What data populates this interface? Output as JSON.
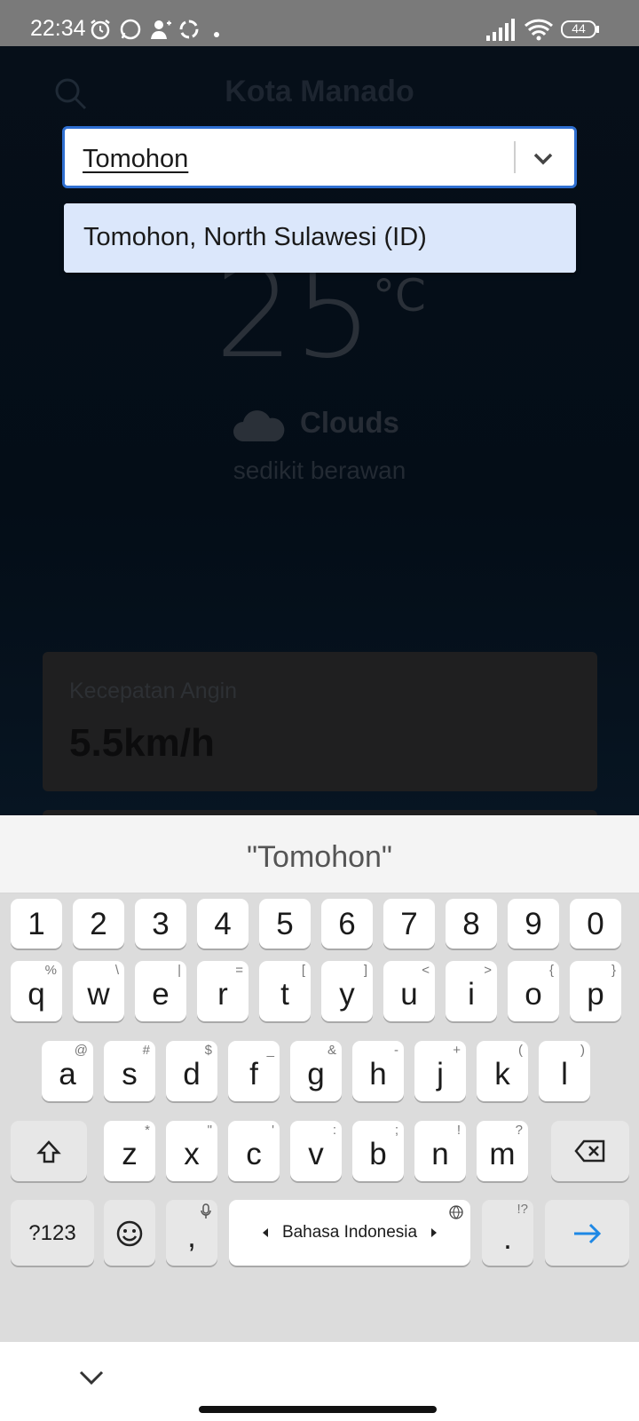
{
  "status_bar": {
    "time": "22:34",
    "battery": "44",
    "icons": [
      "alarm-icon",
      "whatsapp-icon",
      "contact-sync-icon",
      "sync-icon",
      "dot-icon",
      "signal-icon",
      "wifi-icon",
      "battery-icon"
    ]
  },
  "app": {
    "city_title": "Kota Manado",
    "temperature": "25",
    "temperature_unit": "°C",
    "weather_main": "Clouds",
    "weather_description": "sedikit berawan",
    "wind": {
      "label": "Kecepatan Angin",
      "value": "5.5km/h"
    }
  },
  "search": {
    "value": "Tomohon",
    "options": [
      "Tomohon, North Sulawesi (ID)"
    ]
  },
  "keyboard": {
    "suggestion": "\"Tomohon\"",
    "number_row": [
      "1",
      "2",
      "3",
      "4",
      "5",
      "6",
      "7",
      "8",
      "9",
      "0"
    ],
    "row1": [
      {
        "c": "q",
        "s": "%"
      },
      {
        "c": "w",
        "s": "\\"
      },
      {
        "c": "e",
        "s": "|"
      },
      {
        "c": "r",
        "s": "="
      },
      {
        "c": "t",
        "s": "["
      },
      {
        "c": "y",
        "s": "]"
      },
      {
        "c": "u",
        "s": "<"
      },
      {
        "c": "i",
        "s": ">"
      },
      {
        "c": "o",
        "s": "{"
      },
      {
        "c": "p",
        "s": "}"
      }
    ],
    "row2": [
      {
        "c": "a",
        "s": "@"
      },
      {
        "c": "s",
        "s": "#"
      },
      {
        "c": "d",
        "s": "$"
      },
      {
        "c": "f",
        "s": "_"
      },
      {
        "c": "g",
        "s": "&"
      },
      {
        "c": "h",
        "s": "-"
      },
      {
        "c": "j",
        "s": "+"
      },
      {
        "c": "k",
        "s": "("
      },
      {
        "c": "l",
        "s": ")"
      }
    ],
    "row3": [
      {
        "c": "z",
        "s": "*"
      },
      {
        "c": "x",
        "s": "\""
      },
      {
        "c": "c",
        "s": "'"
      },
      {
        "c": "v",
        "s": ":"
      },
      {
        "c": "b",
        "s": ";"
      },
      {
        "c": "n",
        "s": "!"
      },
      {
        "c": "m",
        "s": "?"
      }
    ],
    "symbols_key": "?123",
    "comma_key": ",",
    "space_key": "Bahasa Indonesia",
    "period_key": ".",
    "period_sub": "!?"
  },
  "colors": {
    "accent": "#2f6fd1",
    "option_highlight": "#dbe7fb",
    "enter_arrow": "#1e88e5"
  }
}
